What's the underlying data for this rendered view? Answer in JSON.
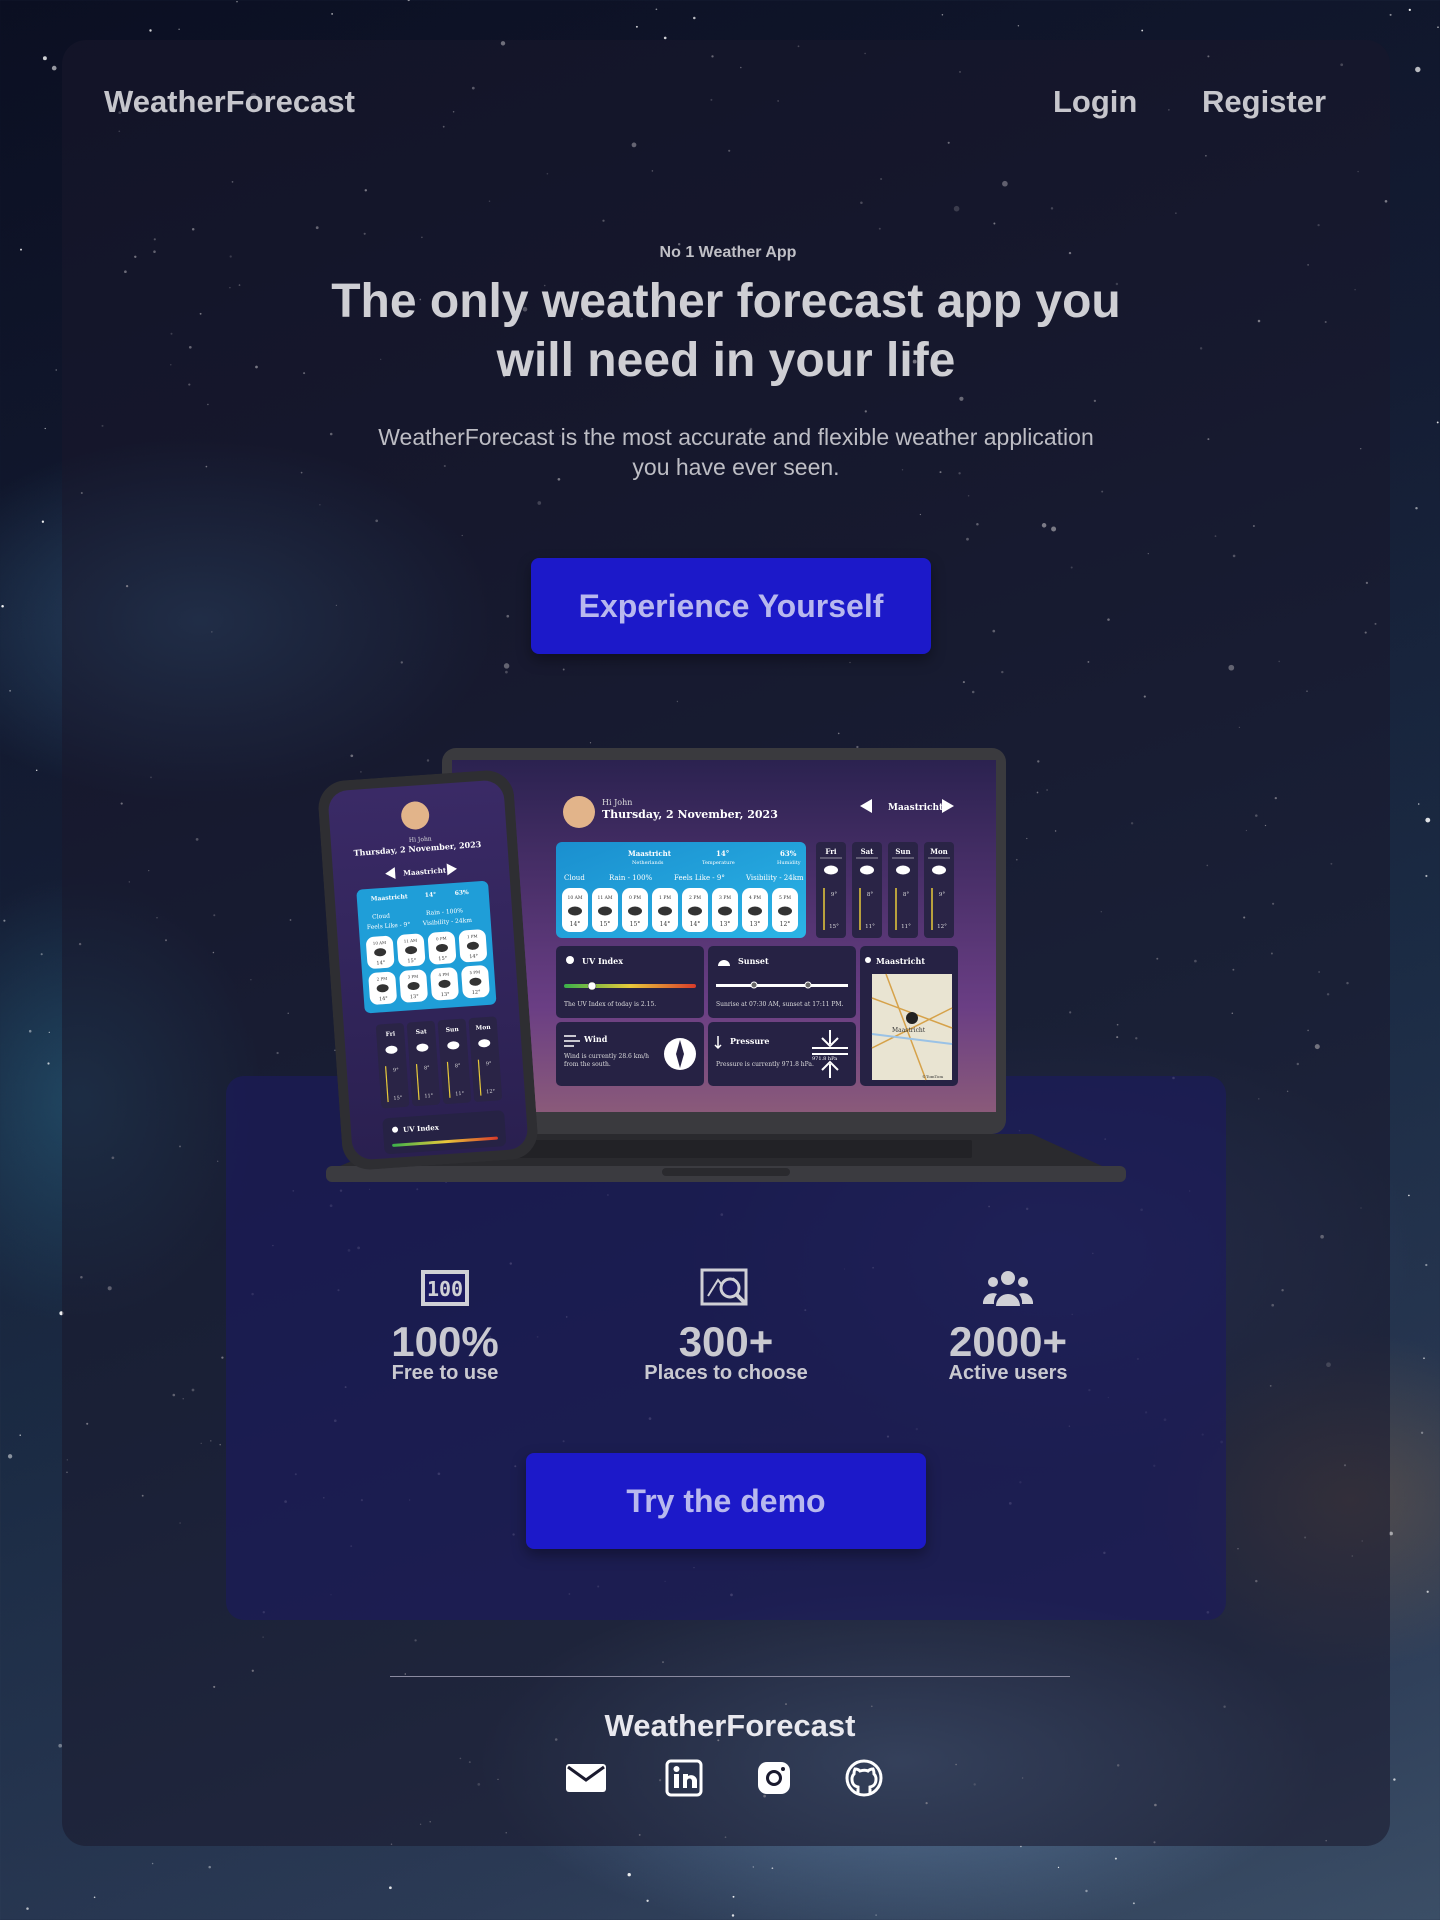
{
  "header": {
    "brand": "WeatherForecast",
    "login_label": "Login",
    "register_label": "Register"
  },
  "hero": {
    "eyebrow": "No 1 Weather App",
    "headline": "The only weather forecast app you will need in your life",
    "subtitle": "WeatherForecast is the most accurate and flexible weather application you have ever seen.",
    "cta_label": "Experience Yourself"
  },
  "mockup": {
    "greeting": "Hi John",
    "date": "Thursday, 2 November, 2023",
    "location": "Maastricht",
    "country": "Netherlands",
    "temperature": "14°",
    "temperature_label": "Temperature",
    "humidity": "63%",
    "humidity_label": "Humidity",
    "conditions": [
      "Cloud",
      "Rain - 100%",
      "Feels Like - 9°",
      "Visibility - 24km"
    ],
    "hourly": [
      {
        "time": "10 AM",
        "temp": "14°"
      },
      {
        "time": "11 AM",
        "temp": "15°"
      },
      {
        "time": "0 PM",
        "temp": "15°"
      },
      {
        "time": "1 PM",
        "temp": "14°"
      },
      {
        "time": "2 PM",
        "temp": "14°"
      },
      {
        "time": "3 PM",
        "temp": "13°"
      },
      {
        "time": "4 PM",
        "temp": "13°"
      },
      {
        "time": "5 PM",
        "temp": "12°"
      }
    ],
    "daily": [
      {
        "day": "Fri",
        "low": "9°",
        "high": "15°"
      },
      {
        "day": "Sat",
        "low": "8°",
        "high": "11°"
      },
      {
        "day": "Sun",
        "low": "8°",
        "high": "11°"
      },
      {
        "day": "Mon",
        "low": "9°",
        "high": "12°"
      }
    ],
    "uv_title": "UV Index",
    "uv_text": "The UV Index of today is 2.15.",
    "sunset_title": "Sunset",
    "sunset_text": "Sunrise at 07:30 AM, sunset at 17:11 PM.",
    "wind_title": "Wind",
    "wind_text_1": "Wind is currently 28.6 km/h",
    "wind_text_2": "from the south.",
    "pressure_title": "Pressure",
    "pressure_text": "Pressure is currently 971.8 hPa.",
    "pressure_value": "971.8 hPa",
    "map_title": "Maastricht",
    "map_city": "Maastricht",
    "map_credit": "©TomTom",
    "phone_hourly": [
      {
        "time": "10 AM",
        "temp": "14°"
      },
      {
        "time": "11 AM",
        "temp": "15°"
      },
      {
        "time": "0 PM",
        "temp": "15°"
      },
      {
        "time": "1 PM",
        "temp": "14°"
      },
      {
        "time": "2 PM",
        "temp": "14°"
      },
      {
        "time": "3 PM",
        "temp": "13°"
      },
      {
        "time": "4 PM",
        "temp": "13°"
      },
      {
        "time": "5 PM",
        "temp": "12°"
      }
    ]
  },
  "stats": [
    {
      "value": "100%",
      "label": "Free to use",
      "icon": "hundred-badge-icon"
    },
    {
      "value": "300+",
      "label": "Places to choose",
      "icon": "map-search-icon"
    },
    {
      "value": "2000+",
      "label": "Active users",
      "icon": "users-icon"
    }
  ],
  "demo_label": "Try the demo",
  "footer": {
    "brand": "WeatherForecast",
    "socials": [
      "mail-icon",
      "linkedin-icon",
      "instagram-icon",
      "github-icon"
    ]
  },
  "colors": {
    "accent_button": "#1c19c9",
    "stats_card": "#1c1a60",
    "panel": "#1a182c",
    "mock_cyan": "#1fa0d8"
  }
}
